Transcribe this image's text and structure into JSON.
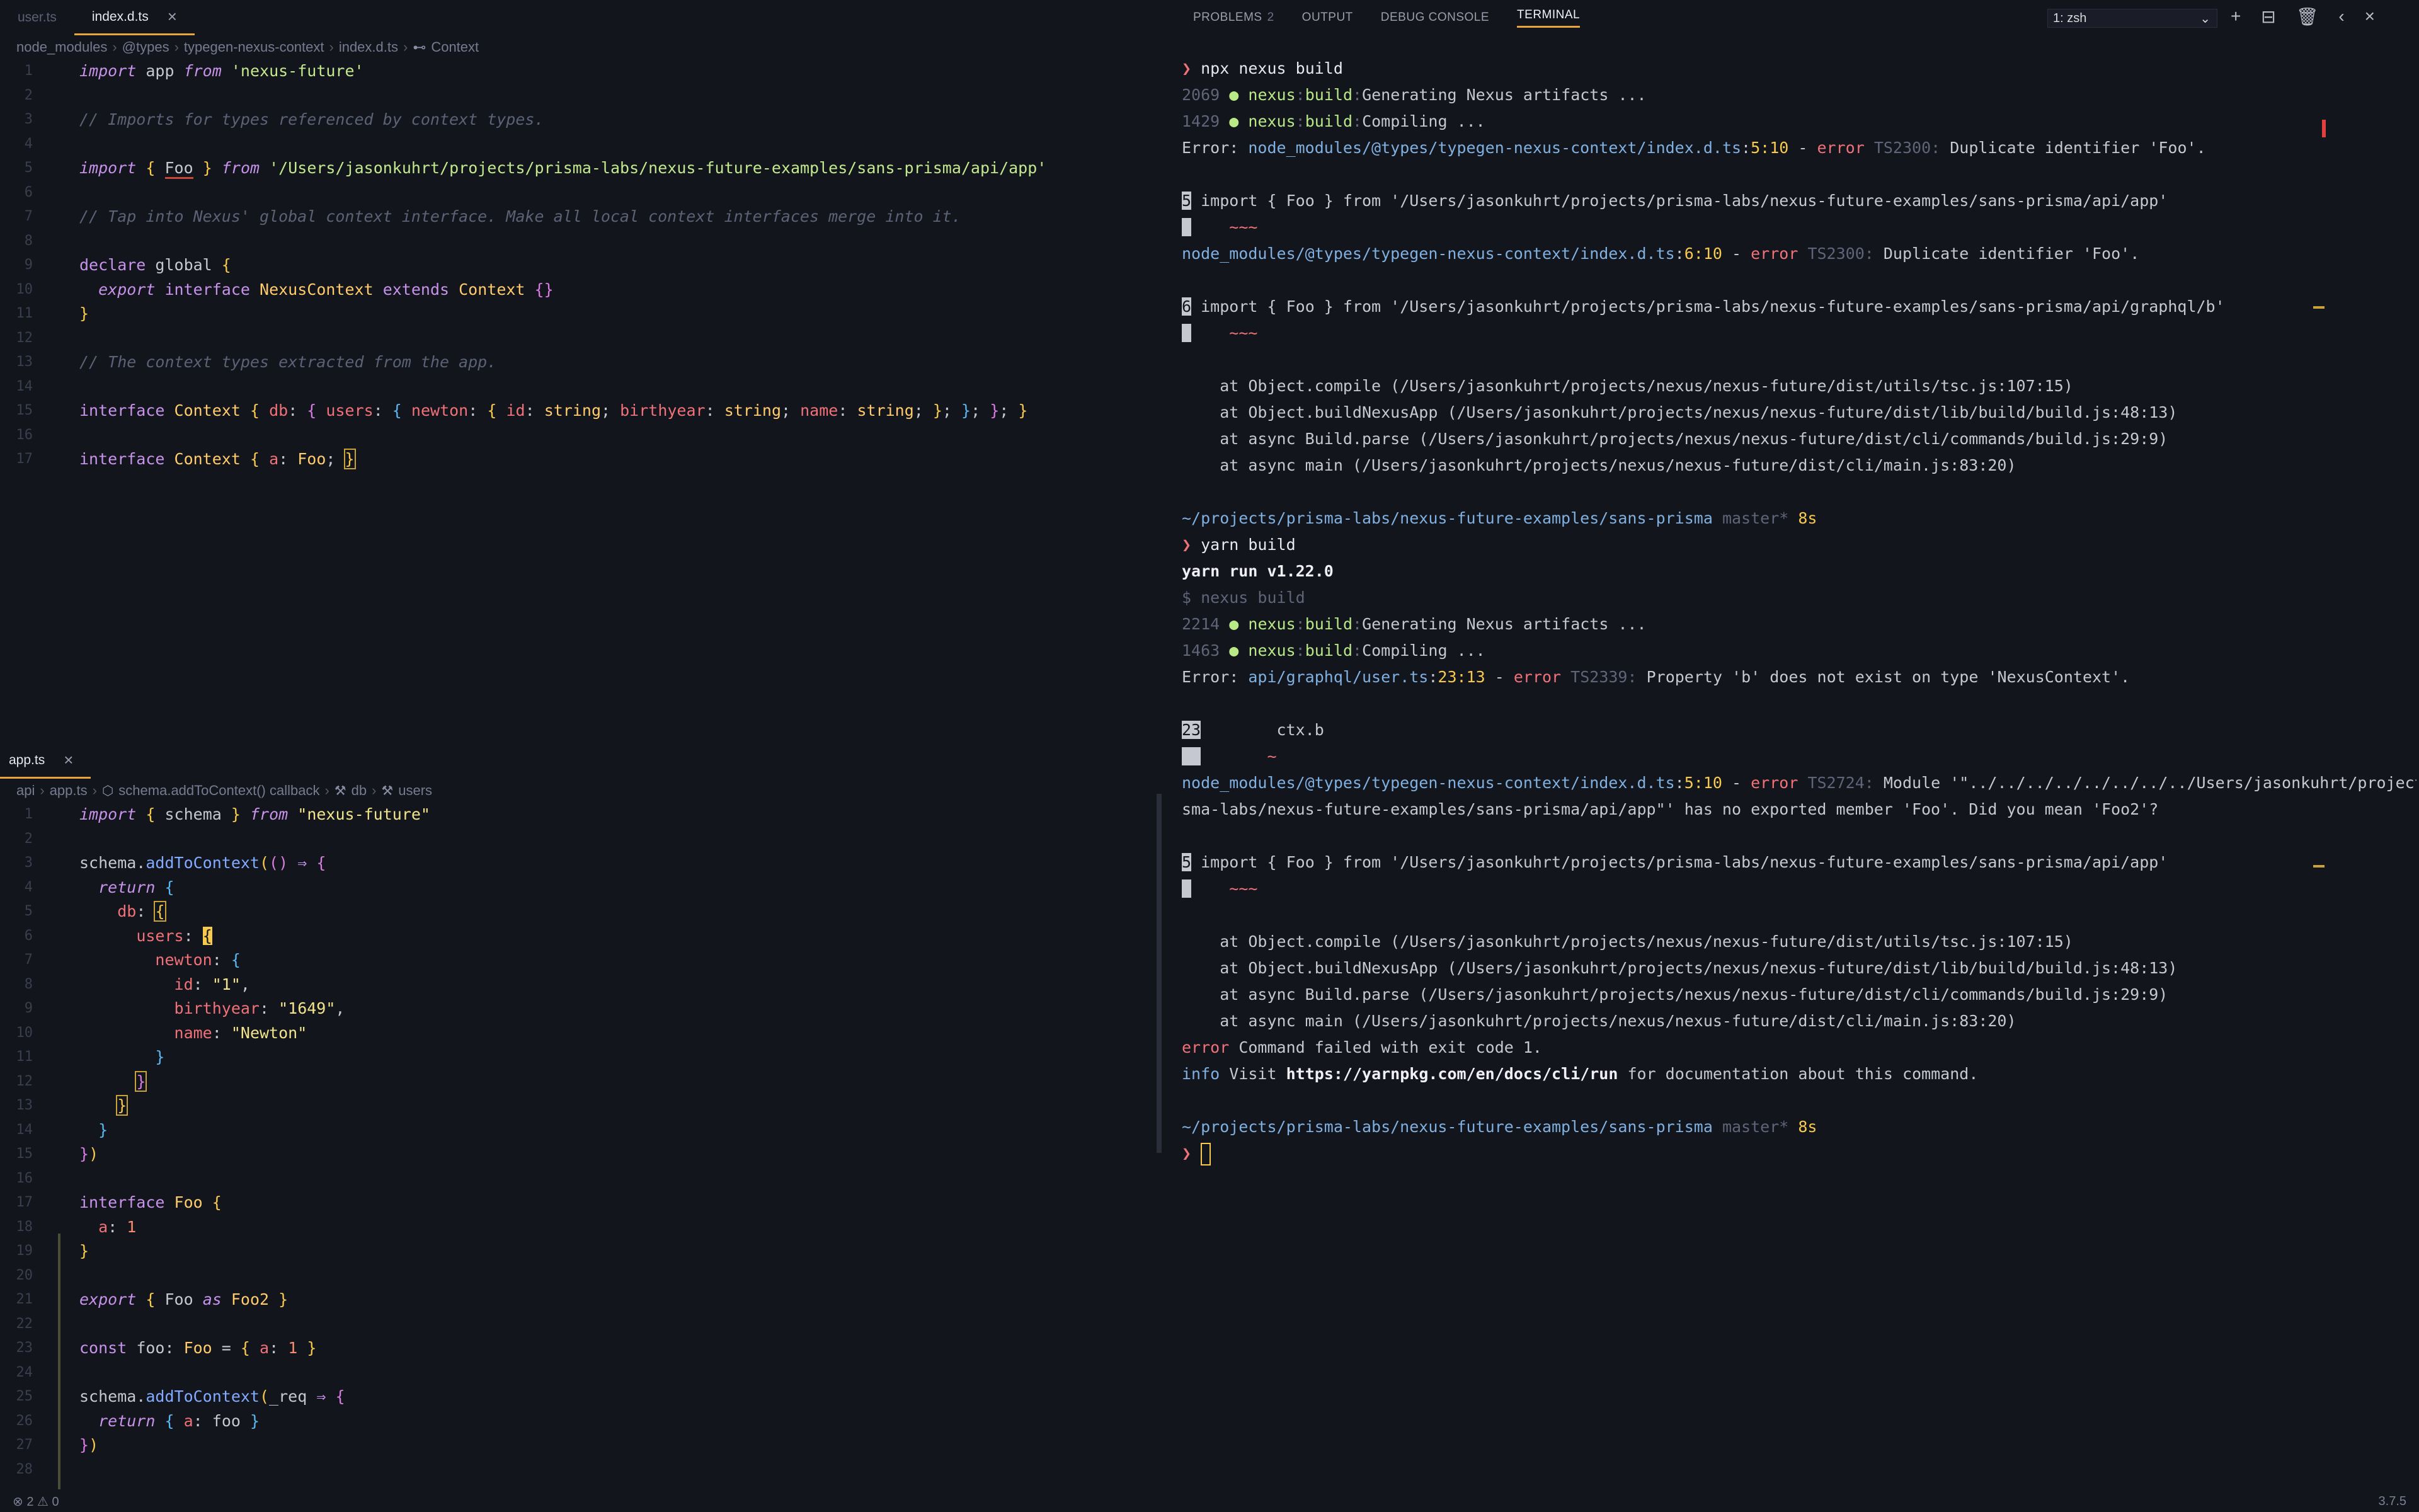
{
  "top_pane": {
    "tabs": [
      {
        "label": "user.ts"
      },
      {
        "label": "index.d.ts"
      }
    ],
    "breadcrumb": [
      "node_modules",
      "@types",
      "typegen-nexus-context",
      "index.d.ts",
      "Context"
    ],
    "line_numbers": [
      "1",
      "2",
      "3",
      "4",
      "5",
      "6",
      "7",
      "8",
      "9",
      "10",
      "11",
      "12",
      "13",
      "14",
      "15",
      "16",
      "17"
    ]
  },
  "bottom_pane": {
    "tabs": [
      {
        "label": "app.ts"
      }
    ],
    "breadcrumb": [
      "api",
      "app.ts",
      "schema.addToContext() callback",
      "db",
      "users"
    ],
    "line_numbers": [
      "1",
      "2",
      "3",
      "4",
      "5",
      "6",
      "7",
      "8",
      "9",
      "10",
      "11",
      "12",
      "13",
      "14",
      "15",
      "16",
      "17",
      "18",
      "19",
      "20",
      "21",
      "22",
      "23",
      "24",
      "25",
      "26",
      "27",
      "28"
    ]
  },
  "panel": {
    "tabs": [
      {
        "label": "PROBLEMS",
        "badge": "2"
      },
      {
        "label": "OUTPUT"
      },
      {
        "label": "DEBUG CONSOLE"
      },
      {
        "label": "TERMINAL"
      }
    ],
    "terminal_select": "1: zsh",
    "icons": [
      "plus-icon",
      "split-icon",
      "trash-icon",
      "chevron-left-icon",
      "close-icon"
    ]
  },
  "terminal": {
    "cmd1": "npx nexus build",
    "ms1": "2069",
    "ms2": "1429",
    "gen_text": "Generating Nexus artifacts ...",
    "compile_text": "Compiling ...",
    "nexus": "nexus",
    "build": "build",
    "err1_path": "node_modules/@types/typegen-nexus-context/index.d.ts",
    "err1_loc": "5:10",
    "err1_code": "TS2300:",
    "err1_msg": "Duplicate identifier 'Foo'.",
    "src1": "import { Foo } from '/Users/jasonkuhrt/projects/prisma-labs/nexus-future-examples/sans-prisma/api/app'",
    "err2_loc": "6:10",
    "src2": "import { Foo } from '/Users/jasonkuhrt/projects/prisma-labs/nexus-future-examples/sans-prisma/api/graphql/b'",
    "tilde": "~~~",
    "stack1": "at Object.compile (/Users/jasonkuhrt/projects/nexus/nexus-future/dist/utils/tsc.js:107:15)",
    "stack2": "at Object.buildNexusApp (/Users/jasonkuhrt/projects/nexus/nexus-future/dist/lib/build/build.js:48:13)",
    "stack3": "at async Build.parse (/Users/jasonkuhrt/projects/nexus/nexus-future/dist/cli/commands/build.js:29:9)",
    "stack4": "at async main (/Users/jasonkuhrt/projects/nexus/nexus-future/dist/cli/main.js:83:20)",
    "cwd": "~/projects/prisma-labs/nexus-future-examples/sans-prisma",
    "branch": "master*",
    "elapsed": "8s",
    "cmd2": "yarn build",
    "yarn_run": "yarn run v1.22.0",
    "dollar": "$ nexus build",
    "ms3": "2214",
    "ms4": "1463",
    "err3_path": "api/graphql/user.ts",
    "err3_loc": "23:13",
    "err3_code": "TS2339:",
    "err3_msg": "Property 'b' does not exist on type 'NexusContext'.",
    "ln23": "23",
    "src3": "        ctx.b",
    "caret": "~",
    "err4_code": "TS2724:",
    "err4_msg_a": "Module '\"../../../../../../../../Users/jasonkuhrt/projects/pri",
    "err4_msg_b": "sma-labs/nexus-future-examples/sans-prisma/api/app\"' has no exported member 'Foo'. Did you mean 'Foo2'?",
    "fail": "Command failed with exit code 1.",
    "info_a": "Visit",
    "info_url": "https://yarnpkg.com/en/docs/cli/run",
    "info_b": "for documentation about this command.",
    "error_word": "error",
    "info_word": "info",
    "error_prefix": "Error:",
    "n5": "5",
    "n6": "6"
  },
  "status": {
    "left": "⊗ 2 ⚠ 0",
    "right": "3.7.5"
  }
}
